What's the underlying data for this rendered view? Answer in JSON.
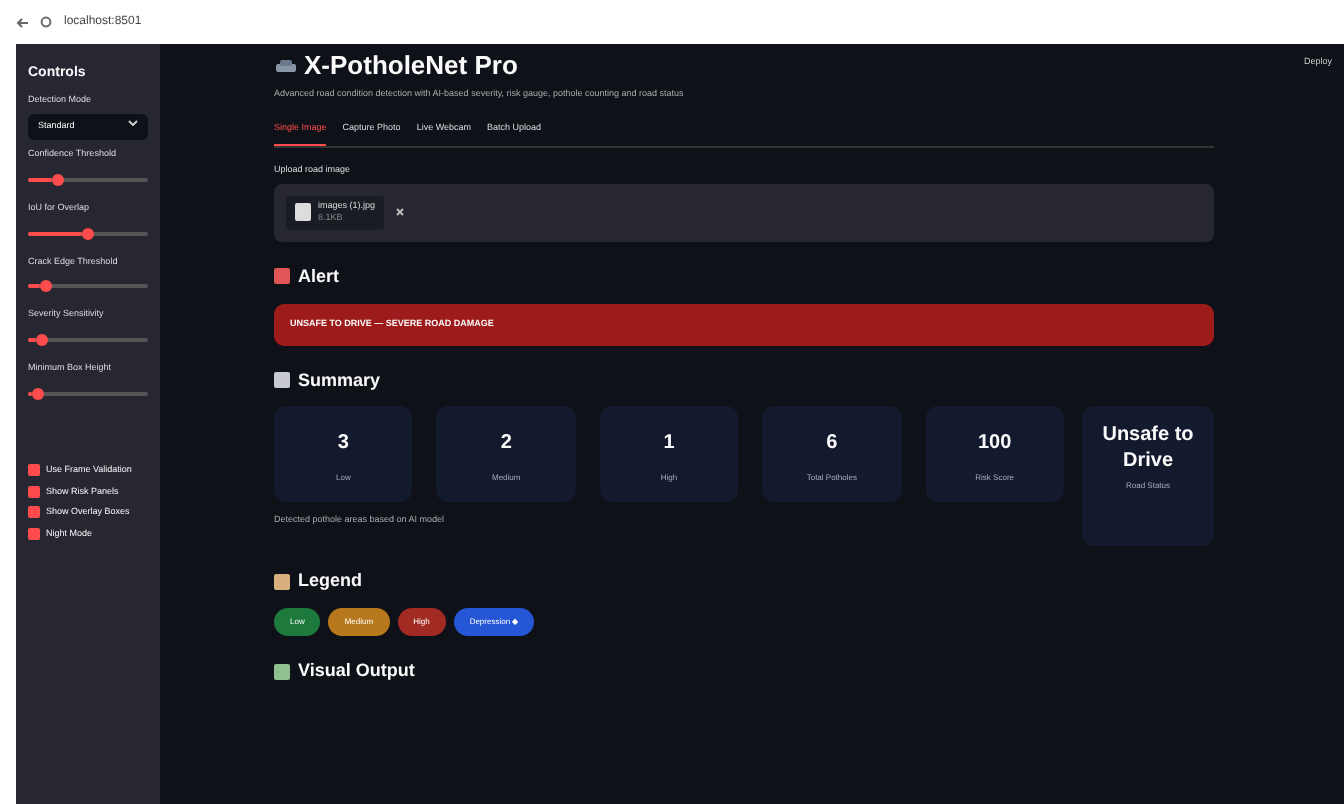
{
  "browser": {
    "address": "localhost:8501"
  },
  "sidebar": {
    "title": "Controls",
    "mode_label": "Detection Mode",
    "mode_value": "Standard",
    "sliders": [
      {
        "label": "Confidence Threshold",
        "level": 0.25
      },
      {
        "label": "IoU for Overlap",
        "level": 0.5
      },
      {
        "label": "Crack Edge Threshold",
        "level": 0.15
      },
      {
        "label": "Severity Sensitivity",
        "level": 0.12
      },
      {
        "label": "Minimum Box Height",
        "level": 0.08
      }
    ],
    "checkboxes": [
      {
        "label": "Use Frame Validation",
        "checked": true
      },
      {
        "label": "Show Risk Panels",
        "checked": true
      },
      {
        "label": "Show Overlay Boxes",
        "checked": true
      },
      {
        "label": "Night Mode",
        "checked": true
      }
    ]
  },
  "header": {
    "menu": "Deploy"
  },
  "title": "X-PotholeNet Pro",
  "subtitle": "Advanced road condition detection with AI-based severity, risk gauge, pothole counting and road status",
  "tabs": [
    {
      "label": "Single Image",
      "selected": true
    },
    {
      "label": "Capture Photo",
      "selected": false
    },
    {
      "label": "Live Webcam",
      "selected": false
    },
    {
      "label": "Batch Upload",
      "selected": false
    }
  ],
  "upload": {
    "label": "Upload road image",
    "file_name": "images (1).jpg",
    "file_size": "8.1KB"
  },
  "alert": {
    "heading": "Alert",
    "message": "UNSAFE TO DRIVE — SEVERE ROAD DAMAGE"
  },
  "summary": {
    "heading": "Summary",
    "cards": [
      {
        "value": "3",
        "label": "Low"
      },
      {
        "value": "2",
        "label": "Medium"
      },
      {
        "value": "1",
        "label": "High"
      },
      {
        "value": "6",
        "label": "Total Potholes"
      },
      {
        "value": "100",
        "label": "Risk Score"
      },
      {
        "value": "Unsafe to Drive",
        "label": "Road Status"
      }
    ],
    "caption": "Detected pothole areas based on AI model"
  },
  "legend": {
    "heading": "Legend",
    "items": [
      {
        "label": "Low",
        "color": "#1e7a3c"
      },
      {
        "label": "Medium",
        "color": "#b8781c"
      },
      {
        "label": "High",
        "color": "#a12a22"
      },
      {
        "label": "Depression ◆",
        "color": "#2456d6"
      }
    ]
  },
  "visual_output": {
    "heading": "Visual Output"
  }
}
